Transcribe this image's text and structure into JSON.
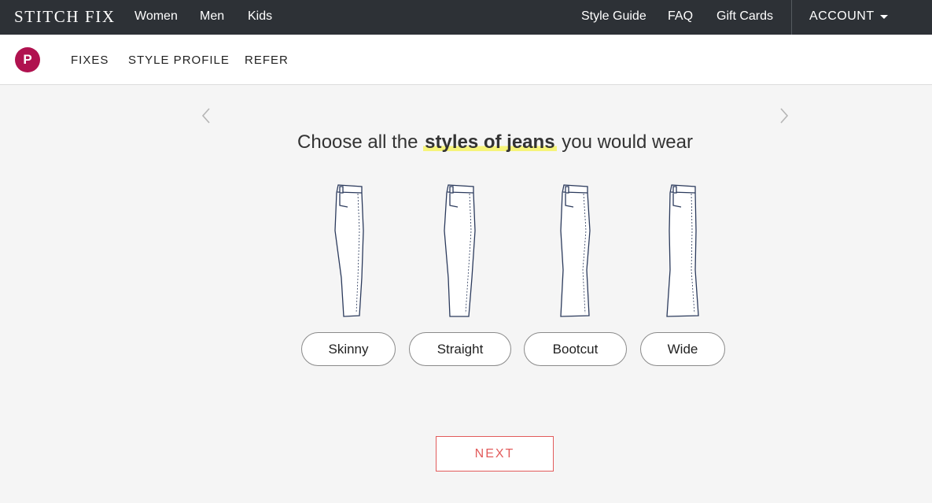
{
  "brand": {
    "logo": "STITCH FIX"
  },
  "topnav": {
    "left": [
      "Women",
      "Men",
      "Kids"
    ],
    "right": [
      "Style Guide",
      "FAQ",
      "Gift Cards"
    ],
    "account": "ACCOUNT"
  },
  "subnav": {
    "avatar_letter": "P",
    "items": [
      "FIXES",
      "STYLE PROFILE",
      "REFER"
    ]
  },
  "question": {
    "prefix": "Choose all the ",
    "highlight": "styles of jeans",
    "suffix": " you would wear"
  },
  "options": [
    "Skinny",
    "Straight",
    "Bootcut",
    "Wide"
  ],
  "next_label": "NEXT",
  "colors": {
    "topbar": "#2d3136",
    "avatar": "#b0124f",
    "highlight": "#f6f47a",
    "next": "#e25b5b",
    "jeans_stroke": "#2b3a5c"
  }
}
